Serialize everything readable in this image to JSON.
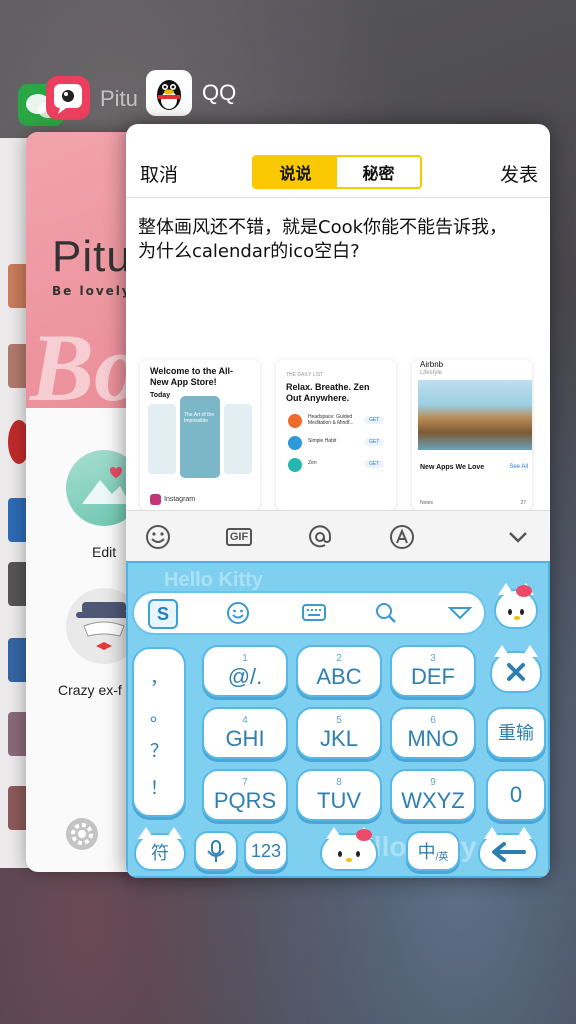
{
  "switcher": {
    "wechat_icon": "wechat-icon",
    "pitu_icon": "pitu-icon",
    "pitu_title": "Pitu",
    "qq_icon": "qq-penguin-icon",
    "qq_title": "QQ"
  },
  "pitu": {
    "logo": "Pitu",
    "tagline": "Be lovely",
    "banner_word": "Bo",
    "edit_label": "Edit",
    "crazy_label": "Crazy ex-f",
    "settings_icon": "gear-icon"
  },
  "qq": {
    "cancel": "取消",
    "post": "发表",
    "tabs": [
      {
        "label": "说说",
        "active": true
      },
      {
        "label": "秘密",
        "active": false
      }
    ],
    "post_text": "整体画风还不错，就是Cook你能不能告诉我，为什么calendar的ico空白?",
    "thumbnails": [
      {
        "title": "Welcome to the All-New App Store!",
        "sub": "Today",
        "card": "The Art of the Impossible",
        "footer": "Instagram"
      },
      {
        "header": "THE DAILY LIST",
        "title": "Relax. Breathe. Zen Out Anywhere.",
        "apps": [
          "Headspace: Guided Meditation & Mindf...",
          "Simple Habit",
          "Zen"
        ],
        "get": "GET"
      },
      {
        "title": "Airbnb",
        "sub": "Lifestyle",
        "section": "New Apps We Love",
        "see_all": "See All",
        "notes": "Notes",
        "count": "27"
      }
    ],
    "toolbar": [
      "smiley-icon",
      "gif-icon",
      "at-icon",
      "apps-a-icon",
      "chevron-down-icon"
    ],
    "toolbar_gif": "GIF"
  },
  "keyboard": {
    "theme_text": "Hello Kitty",
    "top_icons": [
      "sogou-s-icon",
      "emoji-icon",
      "keyboard-icon",
      "search-icon",
      "collapse-icon"
    ],
    "punct": [
      "，",
      "。",
      "？",
      "！"
    ],
    "keys": [
      {
        "n": "1",
        "l": "@/."
      },
      {
        "n": "2",
        "l": "ABC"
      },
      {
        "n": "3",
        "l": "DEF"
      },
      {
        "n": "4",
        "l": "GHI"
      },
      {
        "n": "5",
        "l": "JKL"
      },
      {
        "n": "6",
        "l": "MNO"
      },
      {
        "n": "7",
        "l": "PQRS"
      },
      {
        "n": "8",
        "l": "TUV"
      },
      {
        "n": "9",
        "l": "WXYZ"
      }
    ],
    "delete_icon": "delete-x-icon",
    "reinput": "重输",
    "zero": "0",
    "symbols": "符",
    "mic_icon": "microphone-icon",
    "num": "123",
    "lang": "中",
    "lang_sub": "/英",
    "enter_icon": "enter-arrow-icon",
    "colors": {
      "key_text": "#2e7fb0",
      "keyboard_bg": "#7fd0f0",
      "accent": "#f9c800"
    }
  }
}
